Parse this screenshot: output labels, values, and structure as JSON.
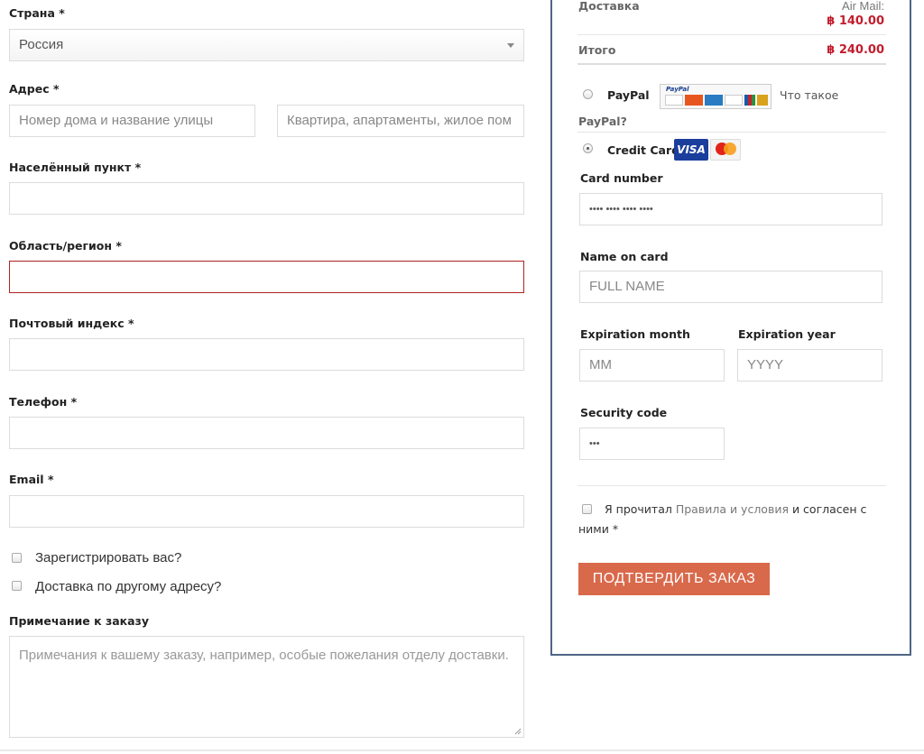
{
  "billing": {
    "country": {
      "label": "Страна",
      "req": "*",
      "value": "Россия"
    },
    "address": {
      "label": "Адрес",
      "req": "*",
      "placeholder1": "Номер дома и название улицы",
      "placeholder2": "Квартира, апартаменты, жилое пом"
    },
    "city": {
      "label": "Населённый пункт",
      "req": "*"
    },
    "region": {
      "label": "Область/регион",
      "req": "*"
    },
    "postcode": {
      "label": "Почтовый индекс",
      "req": "*"
    },
    "phone": {
      "label": "Телефон",
      "req": "*"
    },
    "email": {
      "label": "Email",
      "req": "*"
    },
    "register_label": "Зарегистрировать вас?",
    "ship_other_label": "Доставка по другому адресу?",
    "notes": {
      "label": "Примечание к заказу",
      "placeholder": "Примечания к вашему заказу, например, особые пожелания отделу доставки."
    }
  },
  "summary": {
    "delivery_label": "Доставка",
    "delivery_method": "Air Mail:",
    "delivery_price": "฿ 140.00",
    "total_label": "Итого",
    "total_price": "฿ 240.00"
  },
  "payment": {
    "paypal_label": "PayPal",
    "paypal_what_1": "Что такое",
    "paypal_what_2": "PayPal?",
    "paypal_badge": "PayPal",
    "credit_card_label": "Credit Card",
    "visa_text": "VISA",
    "card_number_label": "Card number",
    "card_number_placeholder": "•••• •••• •••• ••••",
    "name_label": "Name on card",
    "name_placeholder": "FULL NAME",
    "exp_month_label": "Expiration month",
    "exp_month_placeholder": "MM",
    "exp_year_label": "Expiration year",
    "exp_year_placeholder": "YYYY",
    "security_label": "Security code",
    "security_placeholder": "•••",
    "terms_prefix": "Я прочитал",
    "terms_link": "Правила и условия",
    "terms_suffix": "и согласен с",
    "terms_line2": "ними *",
    "submit_label": "ПОДТВЕРДИТЬ ЗАКАЗ"
  },
  "colors": {
    "accent_button": "#d9694b",
    "price_red": "#c21d2e",
    "error_border": "#b22222",
    "panel_border": "#4e6585"
  }
}
